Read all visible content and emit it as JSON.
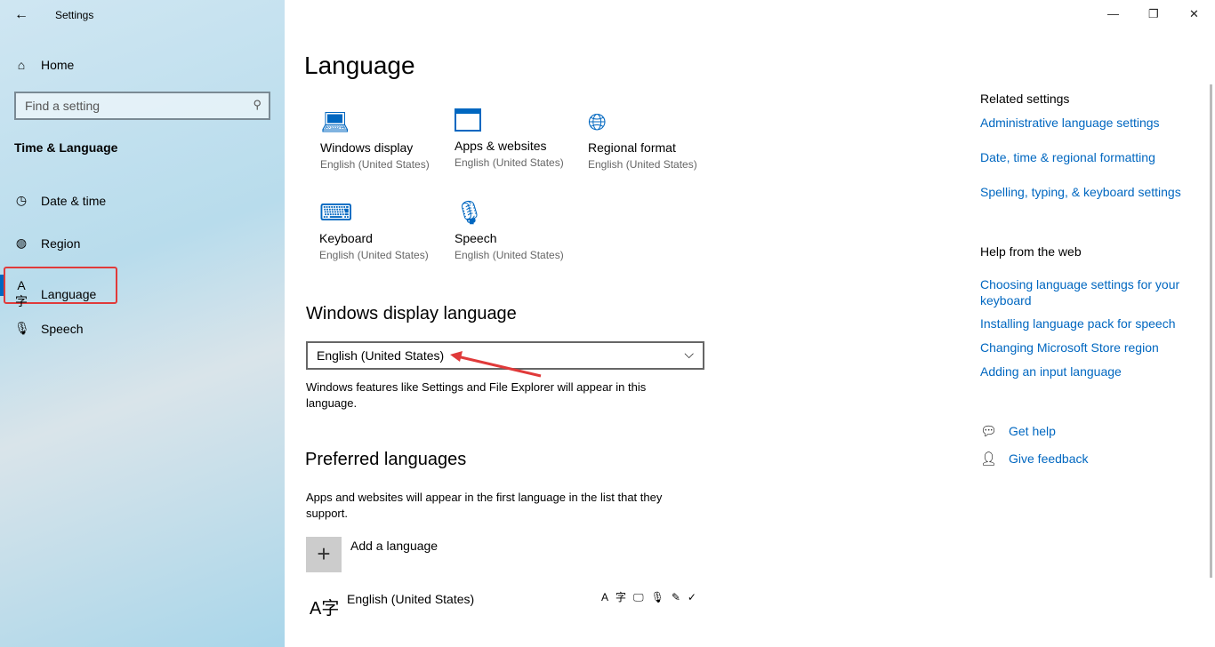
{
  "window": {
    "title": "Settings",
    "back": "←",
    "min": "—",
    "restore": "❐",
    "close": "✕"
  },
  "sidebar": {
    "home": "Home",
    "search_placeholder": "Find a setting",
    "section": "Time & Language",
    "items": [
      {
        "label": "Date & time"
      },
      {
        "label": "Region"
      },
      {
        "label": "Language"
      },
      {
        "label": "Speech"
      }
    ]
  },
  "main": {
    "title": "Language",
    "tiles": [
      {
        "title": "Windows display",
        "sub": "English (United States)"
      },
      {
        "title": "Apps & websites",
        "sub": "English (United States)"
      },
      {
        "title": "Regional format",
        "sub": "English (United States)"
      },
      {
        "title": "Keyboard",
        "sub": "English (United States)"
      },
      {
        "title": "Speech",
        "sub": "English (United States)"
      }
    ],
    "display_heading": "Windows display language",
    "display_value": "English (United States)",
    "display_desc": "Windows features like Settings and File Explorer will appear in this language.",
    "preferred_heading": "Preferred languages",
    "preferred_desc": "Apps and websites will appear in the first language in the list that they support.",
    "add_language": "Add a language",
    "language_entry": "English (United States)"
  },
  "related": {
    "heading": "Related settings",
    "links": [
      "Administrative language settings",
      "Date, time & regional formatting",
      "Spelling, typing, & keyboard settings"
    ],
    "help_heading": "Help from the web",
    "help_links": [
      "Choosing language settings for your keyboard",
      "Installing language pack for speech",
      "Changing Microsoft Store region",
      "Adding an input language"
    ],
    "get_help": "Get help",
    "give_feedback": "Give feedback"
  },
  "colors": {
    "accent": "#0067c0",
    "highlight": "#e03a3a"
  }
}
